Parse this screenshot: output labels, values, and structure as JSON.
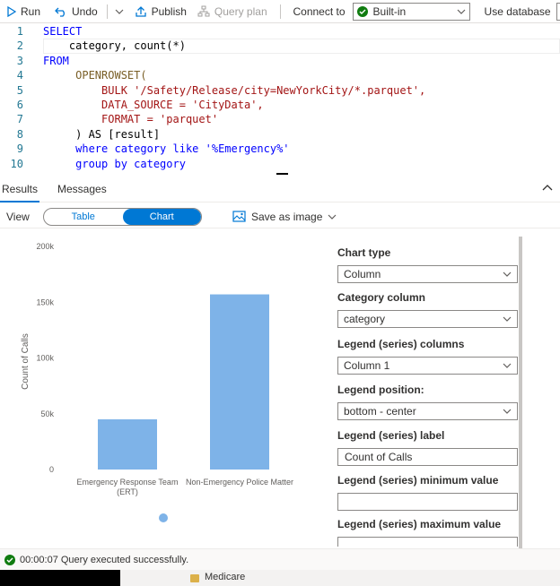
{
  "toolbar": {
    "run_label": "Run",
    "undo_label": "Undo",
    "publish_label": "Publish",
    "query_plan_label": "Query plan",
    "connect_to_label": "Connect to",
    "connection_value": "Built-in",
    "use_database_label": "Use database"
  },
  "editor": {
    "line_numbers": [
      "1",
      "2",
      "3",
      "4",
      "5",
      "6",
      "7",
      "8",
      "9",
      "10"
    ],
    "lines": [
      "SELECT",
      "    category, count(*)",
      "FROM",
      "     OPENROWSET(",
      "         BULK '/Safety/Release/city=NewYorkCity/*.parquet',",
      "         DATA_SOURCE = 'CityData',",
      "         FORMAT = 'parquet'",
      "     ) AS [result]",
      "     where category like '%Emergency%'",
      "     group by category"
    ]
  },
  "results": {
    "tabs": [
      "Results",
      "Messages"
    ],
    "active_tab": "Results",
    "view_label": "View",
    "view_options": [
      "Table",
      "Chart"
    ],
    "active_view": "Chart",
    "save_as_image_label": "Save as image"
  },
  "chart_data": {
    "type": "bar",
    "categories": [
      "Emergency Response Team (ERT)",
      "Non-Emergency Police Matter"
    ],
    "category_label_lines": [
      [
        "Emergency Response Team",
        "(ERT)"
      ],
      [
        "Non-Emergency Police Matter"
      ]
    ],
    "series": [
      {
        "name": "Count of Calls",
        "values": [
          45000,
          157000
        ]
      }
    ],
    "ylabel": "Count of Calls",
    "xlabel": "",
    "ylim": [
      0,
      200000
    ],
    "yticks": [
      0,
      50000,
      100000,
      150000,
      200000
    ],
    "ytick_labels": [
      "0",
      "50k",
      "100k",
      "150k",
      "200k"
    ],
    "grid": false,
    "legend_position": "bottom-center",
    "bar_color": "#7eb3e8"
  },
  "settings": {
    "chart_type_label": "Chart type",
    "chart_type_value": "Column",
    "category_column_label": "Category column",
    "category_column_value": "category",
    "legend_columns_label": "Legend (series) columns",
    "legend_columns_value": "Column 1",
    "legend_position_label": "Legend position:",
    "legend_position_value": "bottom - center",
    "legend_label_label": "Legend (series) label",
    "legend_label_value": "Count of Calls",
    "legend_min_label": "Legend (series) minimum value",
    "legend_min_value": "",
    "legend_max_label": "Legend (series) maximum value",
    "legend_max_value": ""
  },
  "status": {
    "text": "00:00:07 Query executed successfully."
  },
  "explorer": {
    "folder_label": "Medicare"
  },
  "colors": {
    "accent": "#0078d4",
    "success": "#107c10"
  }
}
